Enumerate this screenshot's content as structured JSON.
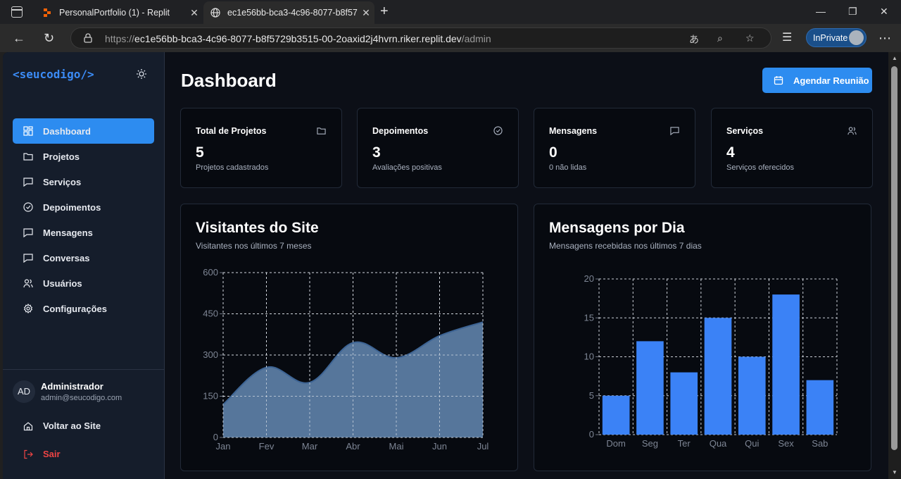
{
  "browser": {
    "tabs": [
      {
        "title": "PersonalPortfolio (1) - Replit",
        "active": false
      },
      {
        "title": "ec1e56bb-bca3-4c96-8077-b8f57",
        "active": true
      }
    ],
    "url_prefix": "https://",
    "url_host": "ec1e56bb-bca3-4c96-8077-b8f5729b3515-00-2oaxid2j4hvrn.riker.replit.dev",
    "url_path": "/admin",
    "inprivate_label": "InPrivate"
  },
  "sidebar": {
    "logo": "<seucodigo/>",
    "items": [
      {
        "label": "Dashboard",
        "icon": "grid-icon",
        "active": true
      },
      {
        "label": "Projetos",
        "icon": "folder-icon"
      },
      {
        "label": "Serviços",
        "icon": "message-square-icon"
      },
      {
        "label": "Depoimentos",
        "icon": "check-circle-icon"
      },
      {
        "label": "Mensagens",
        "icon": "message-square-icon"
      },
      {
        "label": "Conversas",
        "icon": "message-square-icon"
      },
      {
        "label": "Usuários",
        "icon": "users-icon"
      },
      {
        "label": "Configurações",
        "icon": "settings-icon"
      }
    ],
    "user": {
      "initials": "AD",
      "name": "Administrador",
      "email": "admin@seucodigo.com"
    },
    "back_label": "Voltar ao Site",
    "logout_label": "Sair"
  },
  "header": {
    "title": "Dashboard",
    "schedule_label": "Agendar Reunião"
  },
  "stats": [
    {
      "label": "Total de Projetos",
      "value": "5",
      "sub": "Projetos cadastrados",
      "icon": "folder-icon"
    },
    {
      "label": "Depoimentos",
      "value": "3",
      "sub": "Avaliações positivas",
      "icon": "check-circle-icon"
    },
    {
      "label": "Mensagens",
      "value": "0",
      "sub": "0 não lidas",
      "icon": "message-square-icon"
    },
    {
      "label": "Serviços",
      "value": "4",
      "sub": "Serviços oferecidos",
      "icon": "users-icon"
    }
  ],
  "colors": {
    "accent": "#2d8cf0",
    "area_fill": "#5b7ca3",
    "area_line": "#3d6494",
    "bar": "#3b82f6",
    "danger": "#ef4444"
  },
  "chart_data": [
    {
      "type": "area",
      "title": "Visitantes do Site",
      "subtitle": "Visitantes nos últimos 7 meses",
      "categories": [
        "Jan",
        "Fev",
        "Mar",
        "Abr",
        "Mai",
        "Jun",
        "Jul"
      ],
      "values": [
        120,
        255,
        200,
        345,
        290,
        370,
        420
      ],
      "ylim": [
        0,
        600
      ],
      "yticks": [
        0,
        150,
        300,
        450,
        600
      ],
      "grid": true
    },
    {
      "type": "bar",
      "title": "Mensagens por Dia",
      "subtitle": "Mensagens recebidas nos últimos 7 dias",
      "categories": [
        "Dom",
        "Seg",
        "Ter",
        "Qua",
        "Qui",
        "Sex",
        "Sab"
      ],
      "values": [
        5,
        12,
        8,
        15,
        10,
        18,
        7
      ],
      "ylim": [
        0,
        20
      ],
      "yticks": [
        0,
        5,
        10,
        15,
        20
      ],
      "grid": true
    }
  ]
}
